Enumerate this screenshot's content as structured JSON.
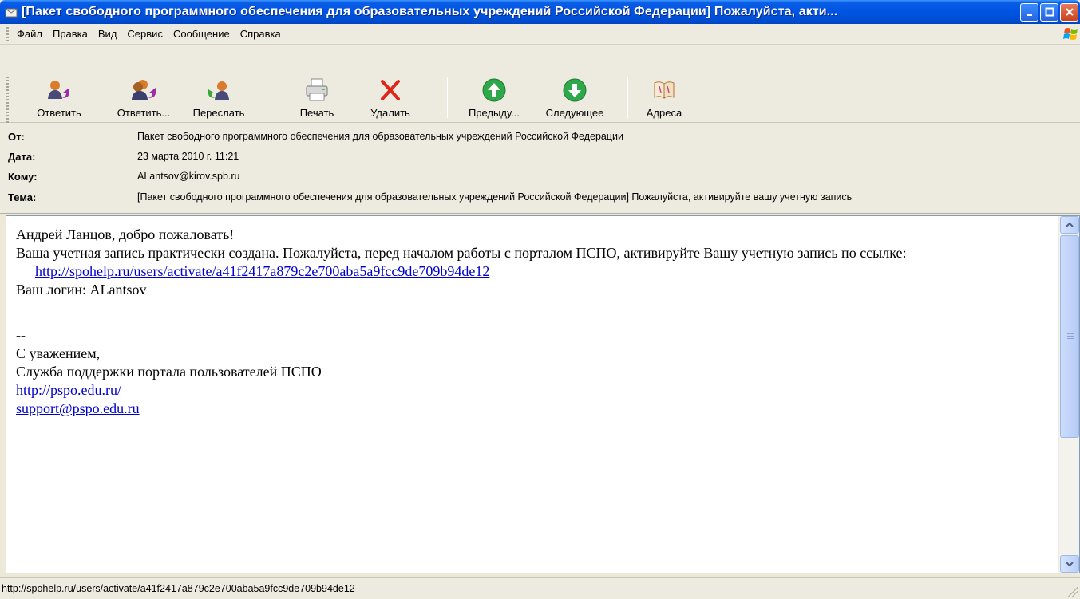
{
  "window": {
    "title": "[Пакет свободного программного обеспечения для образовательных учреждений Российской Федерации] Пожалуйста, акти..."
  },
  "menu": [
    {
      "label": "Файл"
    },
    {
      "label": "Правка"
    },
    {
      "label": "Вид"
    },
    {
      "label": "Сервис"
    },
    {
      "label": "Сообщение"
    },
    {
      "label": "Справка"
    }
  ],
  "toolbar": {
    "buttons": [
      {
        "label": "Ответить",
        "icon": "reply-icon"
      },
      {
        "label": "Ответить...",
        "icon": "reply-all-icon"
      },
      {
        "label": "Переслать",
        "icon": "forward-icon"
      },
      {
        "label": "Печать",
        "icon": "print-icon"
      },
      {
        "label": "Удалить",
        "icon": "delete-icon"
      },
      {
        "label": "Предыду...",
        "icon": "previous-icon"
      },
      {
        "label": "Следующее",
        "icon": "next-icon"
      },
      {
        "label": "Адреса",
        "icon": "address-book-icon"
      }
    ]
  },
  "headers": {
    "from_label": "От:",
    "from_value": "Пакет свободного программного обеспечения для образовательных учреждений Российской Федерации",
    "date_label": "Дата:",
    "date_value": "23 марта 2010 г. 11:21",
    "to_label": "Кому:",
    "to_value": "ALantsov@kirov.spb.ru",
    "subject_label": "Тема:",
    "subject_value": "[Пакет свободного программного обеспечения для образовательных учреждений Российской Федерации] Пожалуйста, активируйте вашу учетную запись"
  },
  "message": {
    "greeting": "Андрей Ланцов, добро пожаловать!",
    "intro": "Ваша учетная запись практически создана. Пожалуйста, перед началом работы с порталом ПСПО, активируйте Вашу учетную запись по ссылке:",
    "activation_link": "http://spohelp.ru/users/activate/a41f2417a879c2e700aba5a9fcc9de709b94de12",
    "login_line": "Ваш логин: ALantsov",
    "signature_sep": "--",
    "regards": "С уважением,",
    "team": "Служба поддержки портала пользователей ПСПО",
    "site_link": "http://pspo.edu.ru/",
    "email_link": "support@pspo.edu.ru"
  },
  "status": {
    "text": "http://spohelp.ru/users/activate/a41f2417a879c2e700aba5a9fcc9de709b94de12"
  },
  "colors": {
    "titlebar": "#0054E3",
    "chrome": "#EDEBDF",
    "link": "#0000CC"
  }
}
